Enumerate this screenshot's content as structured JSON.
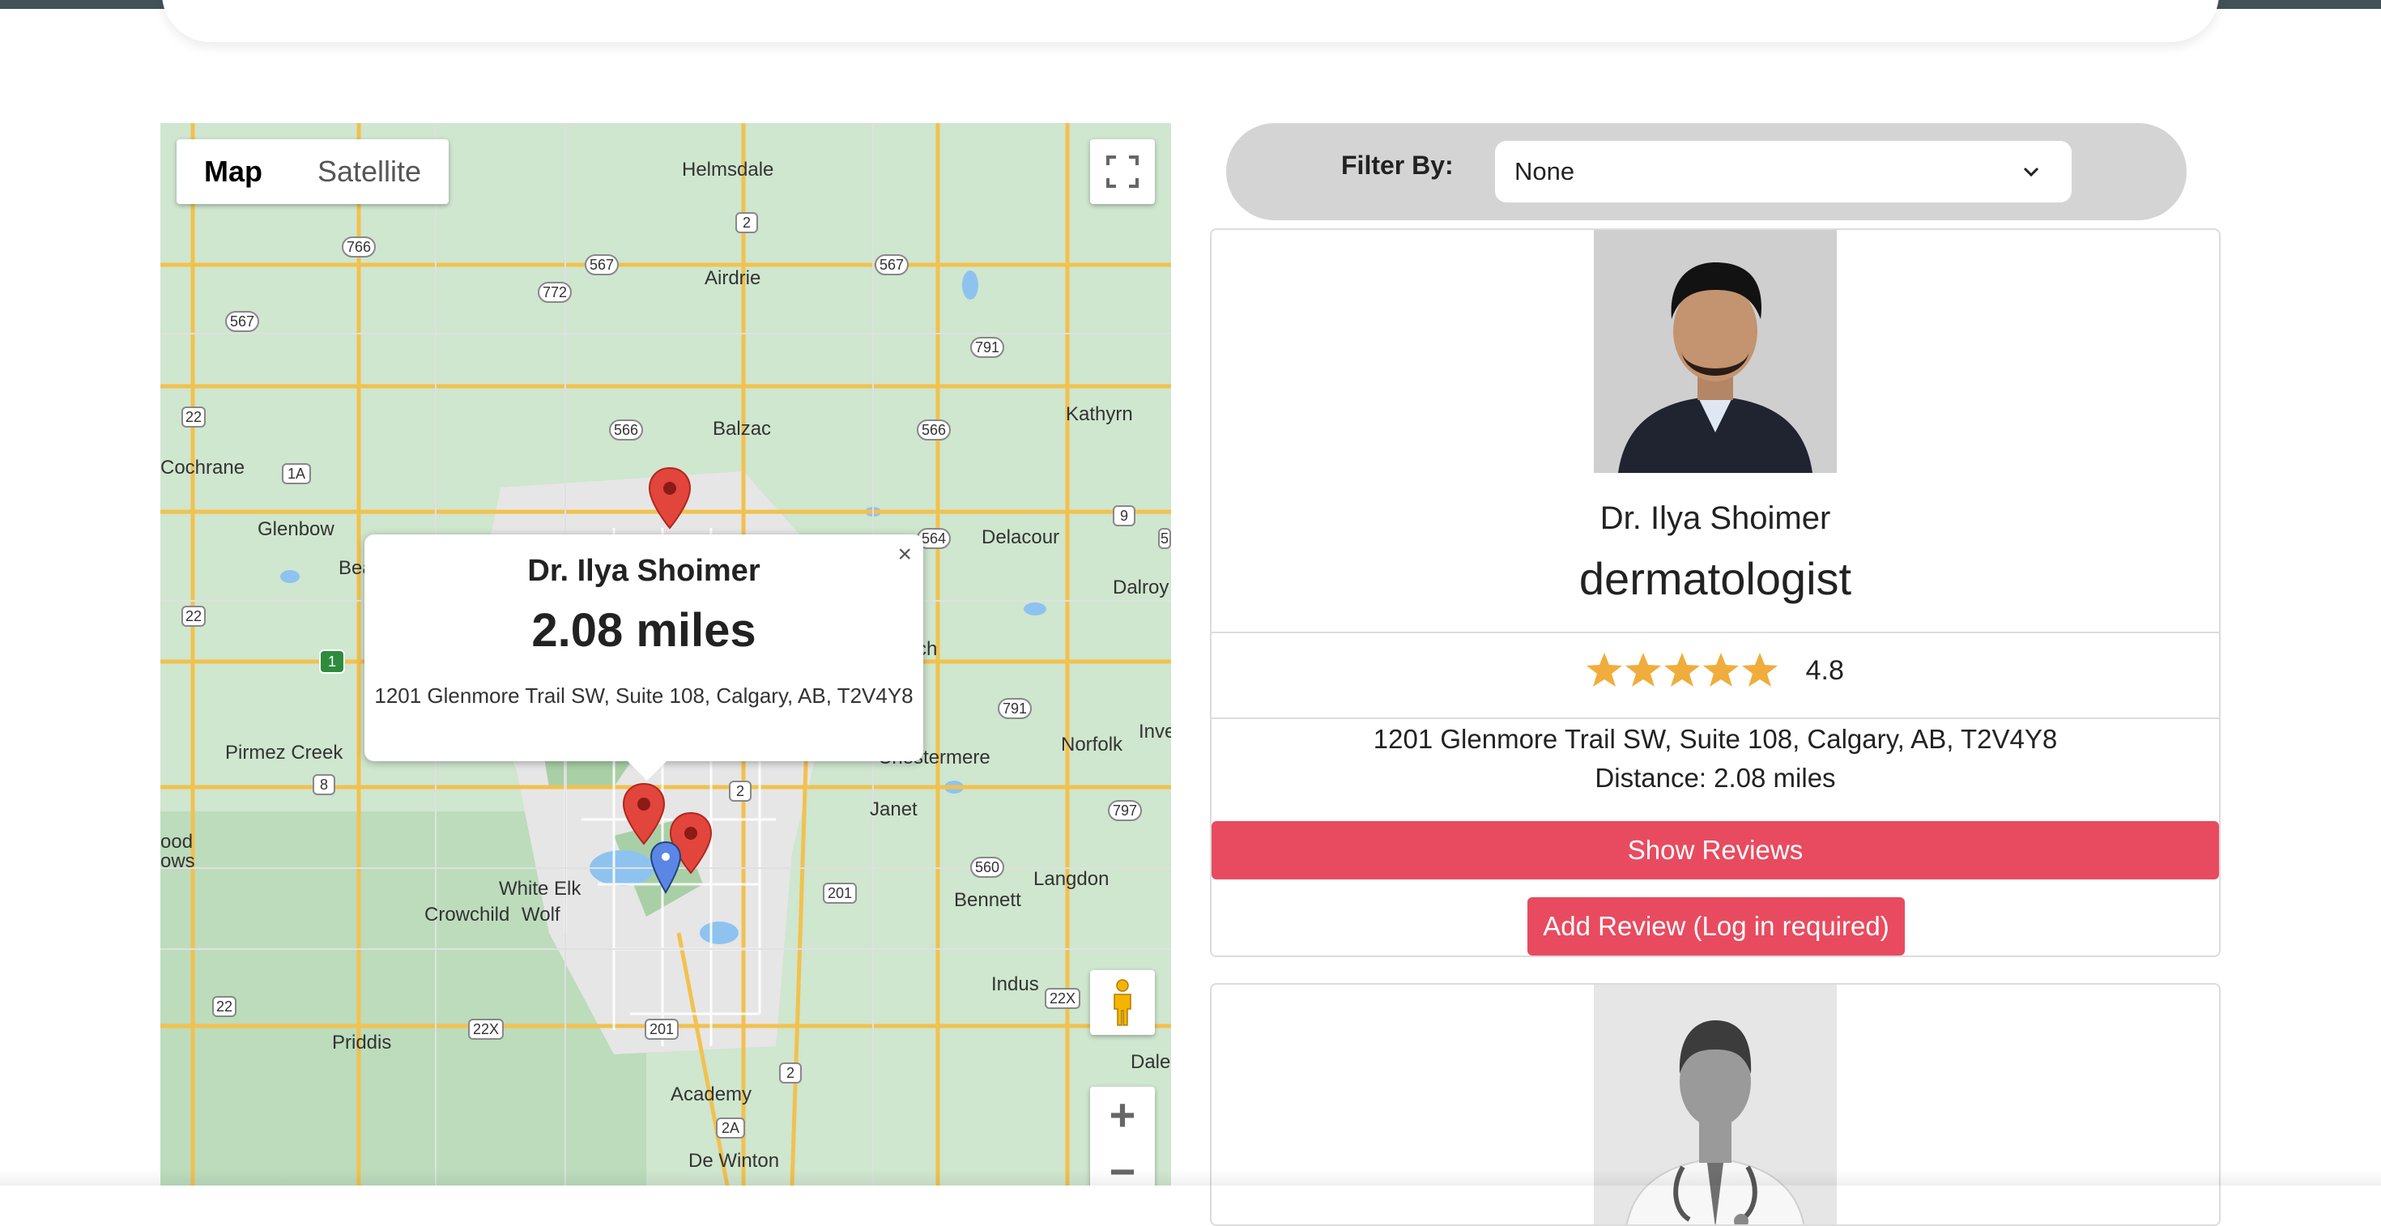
{
  "map": {
    "type_control": {
      "map_label": "Map",
      "satellite_label": "Satellite"
    },
    "place_labels": {
      "helmsdale": "Helmsdale",
      "airdrie": "Airdrie",
      "kathyrn": "Kathyrn",
      "balzac": "Balzac",
      "cochrane": "Cochrane",
      "glenbow": "Glenbow",
      "bea": "Bea",
      "delacour": "Delacour",
      "dalroy": "Dalroy",
      "norfolk": "Norfolk",
      "inve": "Inve",
      "pirmez_creek": "Pirmez Creek",
      "chestermere": "Chestermere",
      "janet": "Janet",
      "ood": "ood",
      "ows": "ows",
      "white_elk": "White Elk",
      "crowchild": "Crowchild",
      "wolf": "Wolf",
      "langdon": "Langdon",
      "bennett": "Bennett",
      "indus": "Indus",
      "dale": "Dale",
      "priddis": "Priddis",
      "academy": "Academy",
      "de_winton": "De Winton",
      "ch": "ch"
    },
    "road_shields": [
      "2",
      "766",
      "567",
      "772",
      "567",
      "567",
      "791",
      "22",
      "566",
      "566",
      "1A",
      "9",
      "564",
      "5",
      "22",
      "1",
      "791",
      "8",
      "2",
      "797",
      "560",
      "201",
      "22",
      "22X",
      "201",
      "22X",
      "2",
      "2A"
    ],
    "info_window": {
      "close": "×",
      "name": "Dr. Ilya Shoimer",
      "distance": "2.08 miles",
      "address": "1201 Glenmore Trail SW, Suite 108, Calgary, AB, T2V4Y8"
    },
    "zoom_in": "+",
    "zoom_out": "−"
  },
  "filter": {
    "label": "Filter By:",
    "selected": "None"
  },
  "cards": [
    {
      "name": "Dr. Ilya Shoimer",
      "specialty": "dermatologist",
      "rating": "4.8",
      "rating_stars": 5,
      "address": "1201 Glenmore Trail SW, Suite 108, Calgary, AB, T2V4Y8",
      "distance": "Distance: 2.08 miles",
      "show_reviews": "Show Reviews",
      "add_review": "Add Review (Log in required)"
    }
  ],
  "colors": {
    "accent": "#e84b5f",
    "star": "#f0ad3c",
    "topbar": "#415158",
    "map_bg": "#cfe6cf",
    "road": "#f2c14e"
  },
  "icons": [
    "fullscreen-icon",
    "pegman-icon",
    "map-marker-icon",
    "user-location-icon",
    "star-icon",
    "chevron-down-icon",
    "close-icon"
  ]
}
